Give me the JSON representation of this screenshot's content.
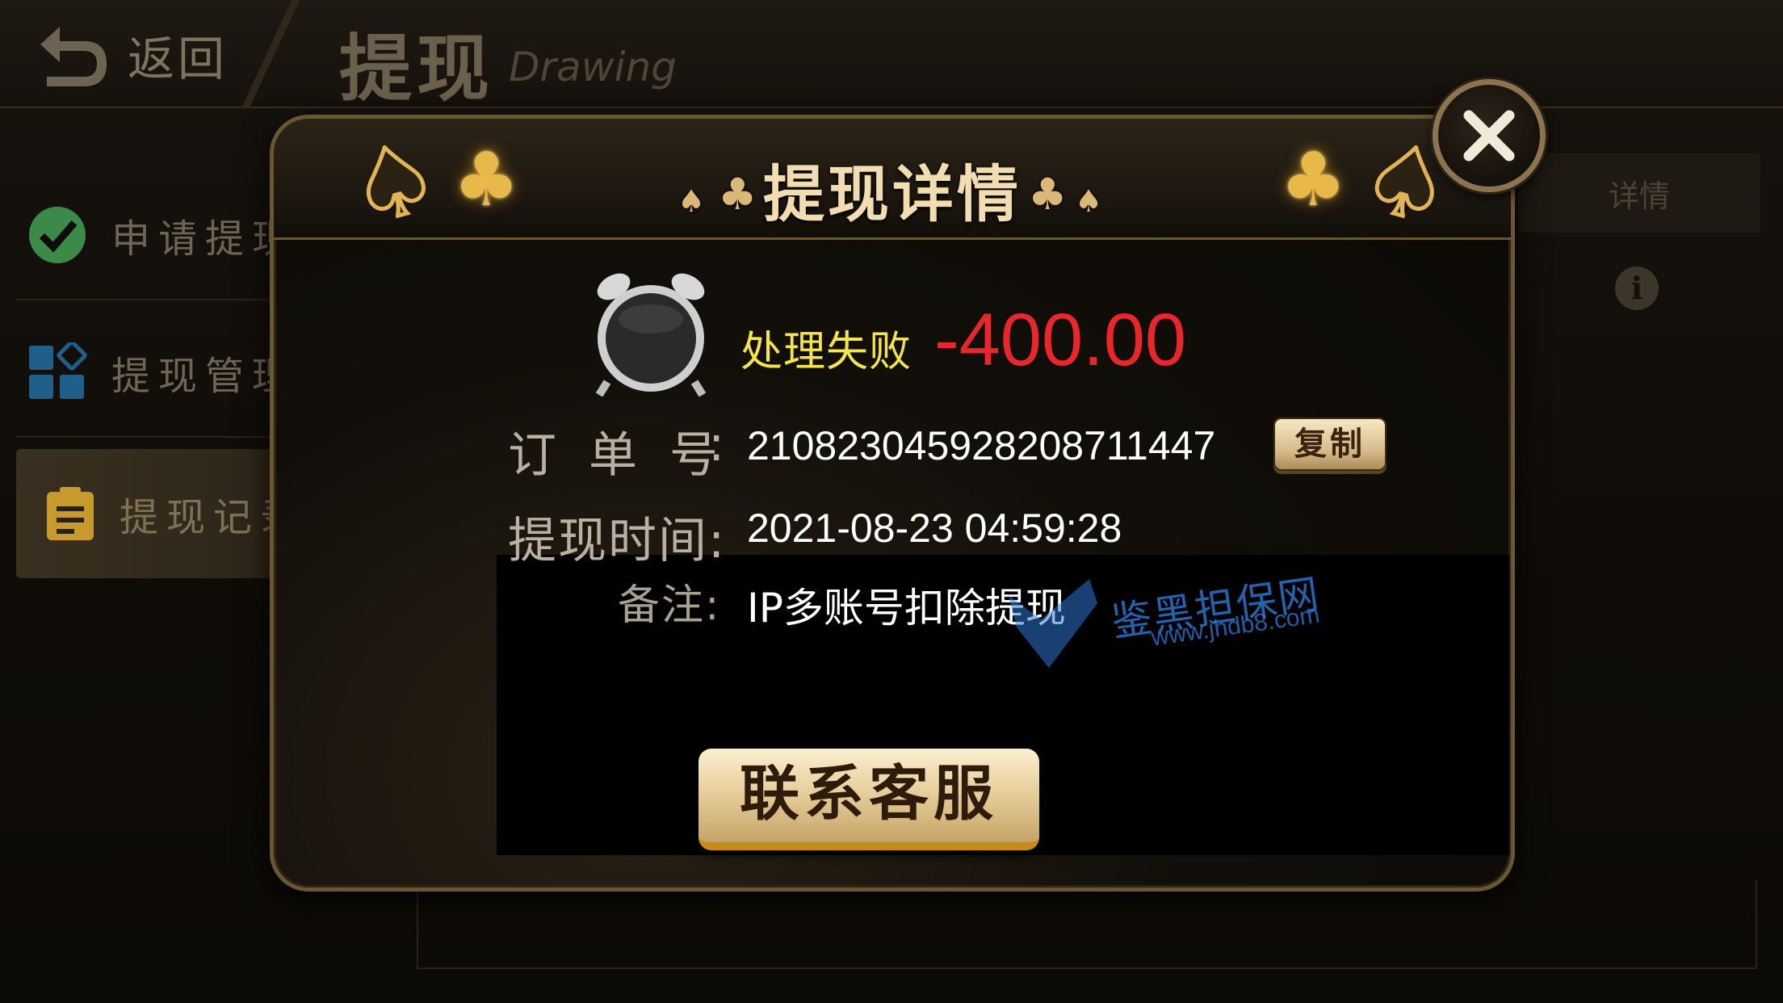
{
  "header": {
    "back_label": "返回",
    "title": "提现",
    "subtitle": "Drawing"
  },
  "sidebar": {
    "items": [
      {
        "label": "申请提现",
        "icon": "check-circle-icon"
      },
      {
        "label": "提现管理",
        "icon": "grid-diamond-icon"
      },
      {
        "label": "提现记录",
        "icon": "clipboard-icon",
        "selected": true
      }
    ]
  },
  "background_table": {
    "details_header": "详情",
    "info_icon": "info-icon"
  },
  "modal": {
    "title": "提现详情",
    "status": "处理失败",
    "amount": "-400.00",
    "order_label": "订单号",
    "order_colon": ":",
    "order_number": "210823045928208711447",
    "copy_label": "复制",
    "time_label": "提现时间:",
    "time_value": "2021-08-23 04:59:28",
    "note_label": "备注:",
    "note_value": "IP多账号扣除提现",
    "contact_label": "联系客服",
    "close_icon": "close-icon",
    "clock_icon": "alarm-clock-icon"
  },
  "watermark": {
    "text": "鉴黑担保网",
    "url": "www.jhdb8.com"
  },
  "colors": {
    "status": "#f3e54a",
    "amount": "#e8262b",
    "accent_gold": "#e1b458",
    "watermark": "#2e7bd8"
  }
}
